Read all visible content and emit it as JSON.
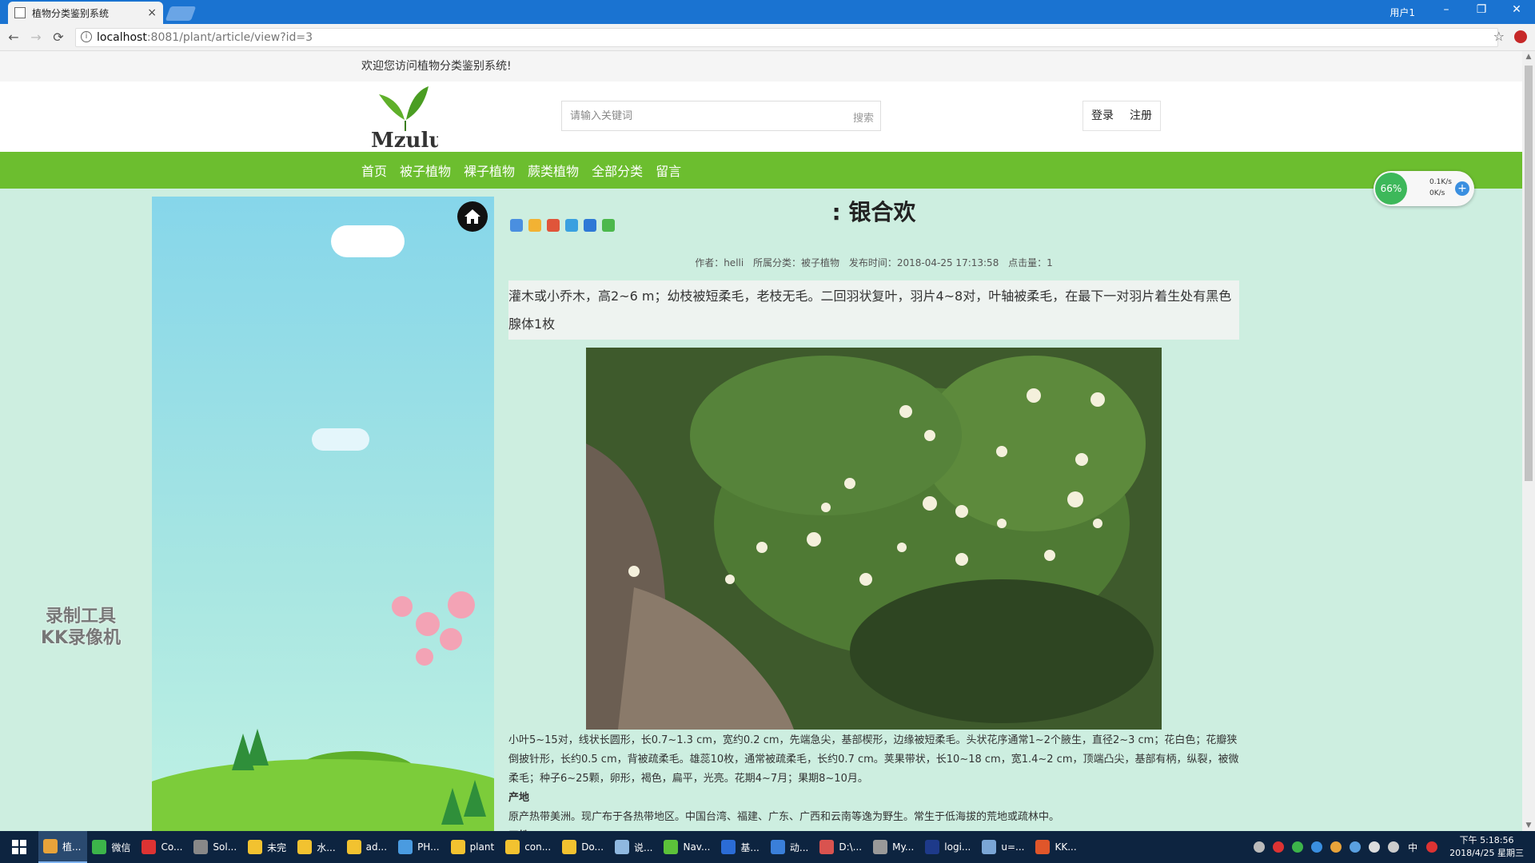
{
  "browser": {
    "tab_title": "植物分类鉴别系统",
    "tab_close": "×",
    "user_label": "用户1",
    "url_host": "localhost",
    "url_path": ":8081/plant/article/view?id=3",
    "back": "←",
    "forward": "→",
    "reload": "⟳",
    "info": "i",
    "star": "☆",
    "minimize": "–",
    "restore": "❐",
    "close": "✕"
  },
  "site": {
    "welcome": "欢迎您访问植物分类鉴别系统!",
    "search_placeholder": "请输入关键词",
    "search_button": "搜索",
    "login": "登录",
    "register": "注册",
    "nav": [
      "首页",
      "被子植物",
      "裸子植物",
      "蕨类植物",
      "全部分类",
      "留言"
    ]
  },
  "article": {
    "title": ": 银合欢",
    "author": "作者：helli",
    "category": "所属分类：被子植物",
    "date": "发布时间：2018-04-25 17:13:58",
    "clicks": "点击量：1",
    "summary": "灌木或小乔木，高2~6 m；幼枝被短柔毛，老枝无毛。二回羽状复叶，羽片4~8对，叶轴被柔毛，在最下一对羽片着生处有黑色腺体1枚",
    "desc": "小叶5~15对，线状长圆形，长0.7~1.3 cm，宽约0.2 cm，先端急尖，基部楔形，边缘被短柔毛。头状花序通常1~2个腋生，直径2~3 cm；花白色；花瓣狭倒披针形，长约0.5 cm，背被疏柔毛。雄蕊10枚，通常被疏柔毛，长约0.7 cm。荚果带状，长10~18 cm，宽1.4~2 cm，顶端凸尖，基部有柄，纵裂，被微柔毛；种子6~25颗，卵形，褐色，扁平，光亮。花期4~7月；果期8~10月。",
    "origin_heading": "产地",
    "origin_text": "原产热带美洲。现广布于各热带地区。中国台湾、福建、广东、广西和云南等逸为野生。常生于低海拔的荒地或疏林中。",
    "habit_heading": "习性"
  },
  "watermark": [
    "录制工具",
    "KK录像机"
  ],
  "speed_widget": {
    "percent": "66%",
    "up": "0.1K/s",
    "down": "0K/s",
    "plus": "+"
  },
  "taskbar": {
    "items": [
      "植...",
      "微信",
      "Co...",
      "Sol...",
      "未完",
      "水...",
      "ad...",
      "PH...",
      "plant",
      "con...",
      "Do...",
      "说...",
      "Nav...",
      "基...",
      "动...",
      "D:\\...",
      "My...",
      "logi...",
      "u=...",
      "KK..."
    ],
    "ime": "中",
    "time": "下午 5:18:56",
    "date": "2018/4/25 星期三"
  },
  "colors": {
    "nav_green": "#6cbe2f",
    "page_bg": "#cdeee0",
    "titlebar": "#1a73d1"
  }
}
